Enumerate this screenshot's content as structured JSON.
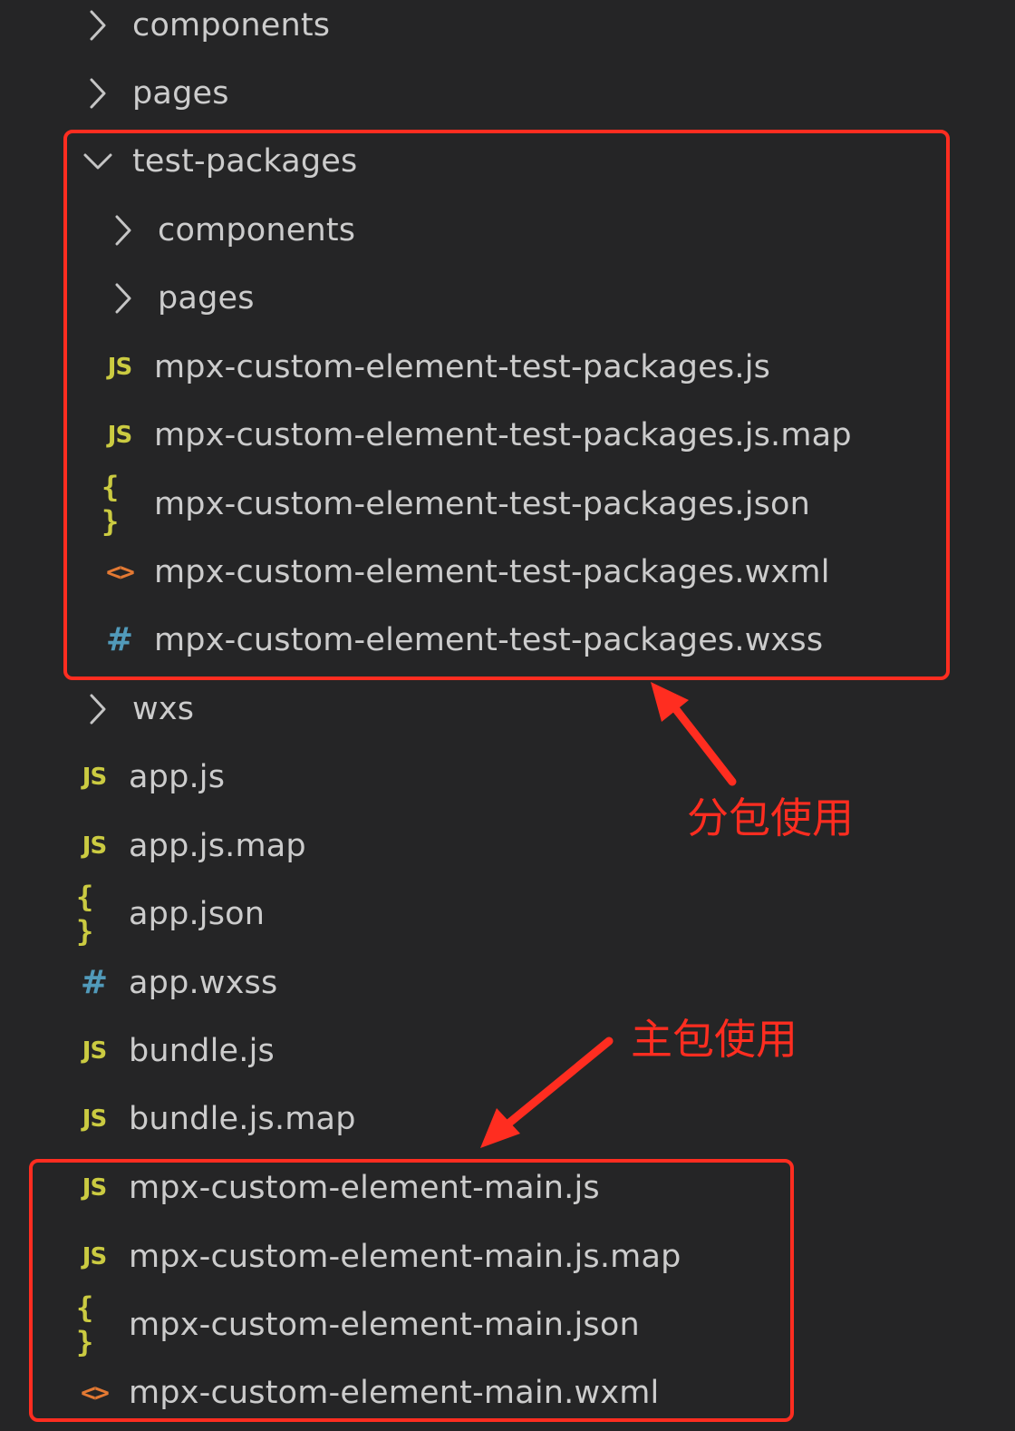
{
  "tree": {
    "items": [
      {
        "label": "components",
        "kind": "folder",
        "expanded": false,
        "icon": "chevron-right-icon"
      },
      {
        "label": "pages",
        "kind": "folder",
        "expanded": false,
        "icon": "chevron-right-icon"
      },
      {
        "label": "test-packages",
        "kind": "folder",
        "expanded": true,
        "icon": "chevron-down-icon"
      },
      {
        "label": "components",
        "kind": "folder",
        "expanded": false,
        "icon": "chevron-right-icon"
      },
      {
        "label": "pages",
        "kind": "folder",
        "expanded": false,
        "icon": "chevron-right-icon"
      },
      {
        "label": "mpx-custom-element-test-packages.js",
        "kind": "js",
        "icon_text": "JS",
        "icon": "js-file-icon"
      },
      {
        "label": "mpx-custom-element-test-packages.js.map",
        "kind": "js",
        "icon_text": "JS",
        "icon": "js-file-icon"
      },
      {
        "label": "mpx-custom-element-test-packages.json",
        "kind": "json",
        "icon_text": "{ }",
        "icon": "json-file-icon"
      },
      {
        "label": "mpx-custom-element-test-packages.wxml",
        "kind": "wxml",
        "icon_text": "<>",
        "icon": "wxml-file-icon"
      },
      {
        "label": "mpx-custom-element-test-packages.wxss",
        "kind": "wxss",
        "icon_text": "#",
        "icon": "wxss-file-icon"
      },
      {
        "label": "wxs",
        "kind": "folder",
        "expanded": false,
        "icon": "chevron-right-icon"
      },
      {
        "label": "app.js",
        "kind": "js",
        "icon_text": "JS",
        "icon": "js-file-icon"
      },
      {
        "label": "app.js.map",
        "kind": "js",
        "icon_text": "JS",
        "icon": "js-file-icon"
      },
      {
        "label": "app.json",
        "kind": "json",
        "icon_text": "{ }",
        "icon": "json-file-icon"
      },
      {
        "label": "app.wxss",
        "kind": "wxss",
        "icon_text": "#",
        "icon": "wxss-file-icon"
      },
      {
        "label": "bundle.js",
        "kind": "js",
        "icon_text": "JS",
        "icon": "js-file-icon"
      },
      {
        "label": "bundle.js.map",
        "kind": "js",
        "icon_text": "JS",
        "icon": "js-file-icon"
      },
      {
        "label": "mpx-custom-element-main.js",
        "kind": "js",
        "icon_text": "JS",
        "icon": "js-file-icon"
      },
      {
        "label": "mpx-custom-element-main.js.map",
        "kind": "js",
        "icon_text": "JS",
        "icon": "js-file-icon"
      },
      {
        "label": "mpx-custom-element-main.json",
        "kind": "json",
        "icon_text": "{ }",
        "icon": "json-file-icon"
      },
      {
        "label": "mpx-custom-element-main.wxml",
        "kind": "wxml",
        "icon_text": "<>",
        "icon": "wxml-file-icon"
      }
    ]
  },
  "annotations": {
    "subpackage_label": "分包使用",
    "main_package_label": "主包使用"
  },
  "colors": {
    "background": "#252526",
    "text": "#cccccc",
    "js_icon": "#cbcb41",
    "json_icon": "#cbcb41",
    "wxml_icon": "#e37933",
    "wxss_icon": "#519aba",
    "annotation": "#ff2d20"
  }
}
